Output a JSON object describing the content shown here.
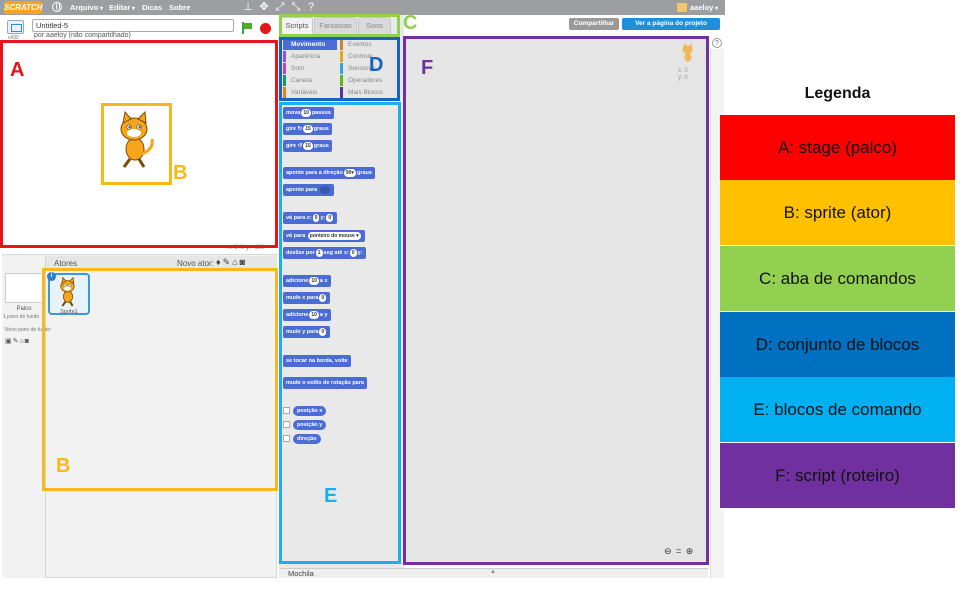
{
  "topbar": {
    "logo": "SCRATCH",
    "menus": [
      "Arquivo",
      "Editar",
      "Dicas",
      "Sobre"
    ],
    "username": "aaeloy"
  },
  "stage_header": {
    "version": "v430",
    "project_title": "Untitled-5",
    "owner": "por aaeloy (não compartilhado)"
  },
  "stage": {
    "coords": "x: 240  y: -180"
  },
  "sprites_pane": {
    "atores_label": "Atores",
    "novo_ator_label": "Novo ator:",
    "palco_label": "Palco",
    "palco_sub": "1 pano de fundo",
    "novo_fundo": "Novo pano de fundo:",
    "sprite1_name": "Sprite1"
  },
  "tabs": [
    "Scripts",
    "Fantasias",
    "Sons"
  ],
  "categories": [
    {
      "label": "Movimento",
      "color": "#4a6cd4"
    },
    {
      "label": "Eventos",
      "color": "#c88330"
    },
    {
      "label": "Aparência",
      "color": "#8a55d7"
    },
    {
      "label": "Controle",
      "color": "#e1a91a"
    },
    {
      "label": "Som",
      "color": "#bb42c3"
    },
    {
      "label": "Sensores",
      "color": "#2ca5e2"
    },
    {
      "label": "Caneta",
      "color": "#0e9a6c"
    },
    {
      "label": "Operadores",
      "color": "#5cb712"
    },
    {
      "label": "Variáveis",
      "color": "#ee7d16"
    },
    {
      "label": "Mais Blocos",
      "color": "#632d99"
    }
  ],
  "blocks": {
    "mova_a": "mova",
    "mova_v": "10",
    "mova_b": "passos",
    "gire1_a": "gire",
    "gire1_i": "↻",
    "gire1_v": "15",
    "gire1_b": "graus",
    "gire2_a": "gire",
    "gire2_i": "↺",
    "gire2_v": "15",
    "gire2_b": "graus",
    "aponte_dir_a": "aponte para a direção",
    "aponte_dir_v": "90▾",
    "aponte_dir_b": "graus",
    "aponte_para": "aponte para",
    "va_a": "vá para x:",
    "va_x": "0",
    "va_b": "y:",
    "va_y": "0",
    "va_ponteiro_a": "vá para",
    "va_ponteiro_v": "ponteiro do mouse ▾",
    "deslize_a": "deslize por",
    "deslize_v": "1",
    "deslize_b": "seg até x:",
    "deslize_x": "0",
    "deslize_c": "y:",
    "adic_x_a": "adicione",
    "adic_x_v": "10",
    "adic_x_b": "a x",
    "mude_x_a": "mude x para",
    "mude_x_v": "0",
    "adic_y_a": "adicione",
    "adic_y_v": "10",
    "adic_y_b": "a y",
    "mude_y_a": "mude y para",
    "mude_y_v": "0",
    "borda": "se tocar na borda, volte",
    "estilo": "mude o estilo de rotação para",
    "posx": "posição x",
    "posy": "posição y",
    "direcao": "direção"
  },
  "scripts": {
    "compartilhar": "Compartilhar",
    "ver_pagina": "Ver a página do projeto",
    "xy_x": "x: 0",
    "xy_y": "y: 0",
    "help": "?"
  },
  "mochila": "Mochila",
  "annotations": {
    "A": {
      "letter": "A",
      "color": "#e8141b"
    },
    "B": {
      "letter": "B",
      "color": "#f7b91a"
    },
    "C": {
      "letter": "C",
      "color": "#8fd14f"
    },
    "D": {
      "letter": "D",
      "color": "#1565c0"
    },
    "E": {
      "letter": "E",
      "color": "#1ab0ed"
    },
    "F": {
      "letter": "F",
      "color": "#7030a0"
    }
  },
  "legend": {
    "title": "Legenda",
    "items": [
      {
        "text": "A: stage (palco)",
        "color": "#ff0000"
      },
      {
        "text": "B: sprite (ator)",
        "color": "#ffc000"
      },
      {
        "text": "C: aba de comandos",
        "color": "#92d050"
      },
      {
        "text": "D: conjunto de blocos",
        "color": "#0070c0"
      },
      {
        "text": "E: blocos de comando",
        "color": "#00b0f0"
      },
      {
        "text": "F: script (roteiro)",
        "color": "#7030a0"
      }
    ]
  }
}
